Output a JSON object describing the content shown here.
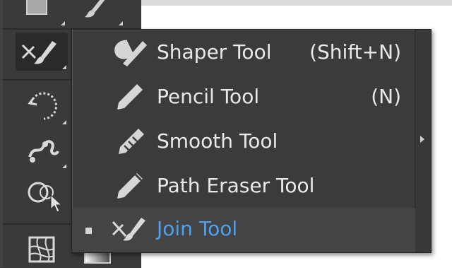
{
  "flyout": {
    "items": [
      {
        "label": "Shaper Tool",
        "shortcut": "(Shift+N)",
        "icon": "shaper-icon",
        "selected": false
      },
      {
        "label": "Pencil Tool",
        "shortcut": "(N)",
        "icon": "pencil-icon",
        "selected": false
      },
      {
        "label": "Smooth Tool",
        "shortcut": "",
        "icon": "smooth-icon",
        "selected": false
      },
      {
        "label": "Path Eraser Tool",
        "shortcut": "",
        "icon": "path-eraser-icon",
        "selected": false
      },
      {
        "label": "Join Tool",
        "shortcut": "",
        "icon": "join-icon",
        "selected": true
      }
    ]
  },
  "toolbar": {
    "tools": [
      "rectangle-icon",
      "paintbrush-icon",
      "join-tool-icon",
      "rotate-icon",
      "puppet-warp-icon",
      "shape-builder-icon",
      "mesh-icon",
      "gradient-icon"
    ]
  },
  "colors": {
    "panel": "#3b3b3b",
    "toolbar": "#434343",
    "highlight_text": "#4ea1f2",
    "text": "#e9e9e9"
  }
}
